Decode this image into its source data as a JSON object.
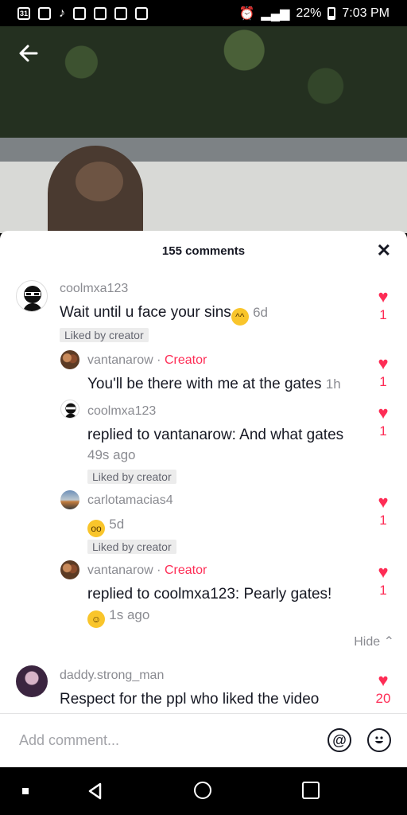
{
  "status_bar": {
    "left_icons": [
      "calendar-icon",
      "instagram-icon",
      "tiktok-icon",
      "instagram-icon",
      "messages-icon",
      "image-icon",
      "download-icon"
    ],
    "calendar_day": "31",
    "battery": "22%",
    "time": "7:03 PM"
  },
  "header": {
    "title": "155 comments",
    "close_icon": "close-icon"
  },
  "comments": [
    {
      "username": "coolmxa123",
      "text": "Wait until u face your sins",
      "emoji": "sweat-smile-emoji",
      "time": "6d",
      "liked_by": "Liked by creator",
      "likes": "1"
    },
    {
      "username": "vantanarow",
      "creator_label": "Creator",
      "text": "You'll be there with me at the gates",
      "time": "1h",
      "likes": "1"
    },
    {
      "username": "coolmxa123",
      "text": "replied to vantanarow: And what gates",
      "time": "49s ago",
      "liked_by": "Liked by creator",
      "likes": "1"
    },
    {
      "username": "carlotamacias4",
      "emoji": "flushed-emoji",
      "time": "5d",
      "liked_by": "Liked by creator",
      "likes": "1"
    },
    {
      "username": "vantanarow",
      "creator_label": "Creator",
      "text": "replied to coolmxa123: Pearly gates!",
      "emoji": "grin-emoji",
      "time": "1s ago",
      "likes": "1"
    },
    {
      "username": "daddy.strong_man",
      "text": "Respect for the ppl who liked the video",
      "likes": "20"
    }
  ],
  "hide_label": "Hide",
  "input": {
    "placeholder": "Add comment..."
  },
  "colors": {
    "accent": "#fe2c55",
    "text": "#161823",
    "muted": "#8a8b91"
  }
}
